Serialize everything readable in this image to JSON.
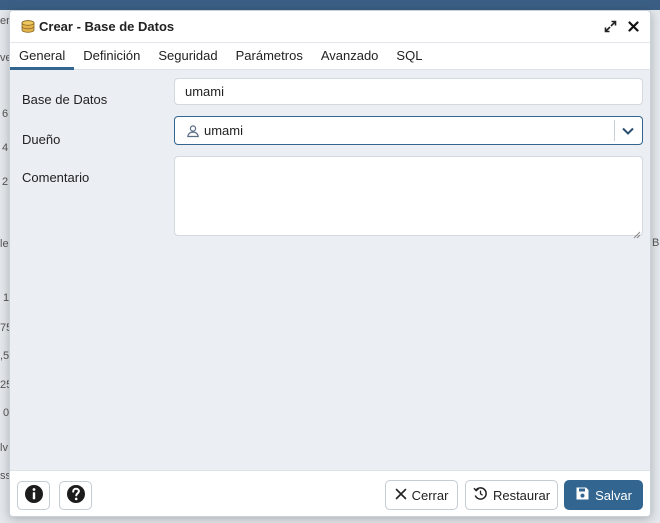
{
  "background": {
    "fragments": [
      "er",
      "ve",
      "6",
      "4",
      "2",
      "le",
      "1",
      "75",
      ",5",
      "25",
      "0",
      "lv",
      "ss",
      "B"
    ]
  },
  "dialog": {
    "title": "Crear - Base de Datos",
    "title_icon": "database-icon",
    "actions": {
      "maximize_icon": "expand-icon",
      "close_icon": "close-icon"
    }
  },
  "tabs": [
    {
      "label": "General",
      "active": true
    },
    {
      "label": "Definición",
      "active": false
    },
    {
      "label": "Seguridad",
      "active": false
    },
    {
      "label": "Parámetros",
      "active": false
    },
    {
      "label": "Avanzado",
      "active": false
    },
    {
      "label": "SQL",
      "active": false
    }
  ],
  "form": {
    "database": {
      "label": "Base de Datos",
      "value": "umami"
    },
    "owner": {
      "label": "Dueño",
      "value": "umami",
      "icon": "user-icon"
    },
    "comment": {
      "label": "Comentario",
      "value": ""
    }
  },
  "footer": {
    "info_icon": "info-icon",
    "help_icon": "help-icon",
    "close_label": "Cerrar",
    "reset_label": "Restaurar",
    "save_label": "Salvar"
  },
  "colors": {
    "accent": "#326690",
    "content_bg": "#ebeef3",
    "topbar": "#3b5f84"
  }
}
